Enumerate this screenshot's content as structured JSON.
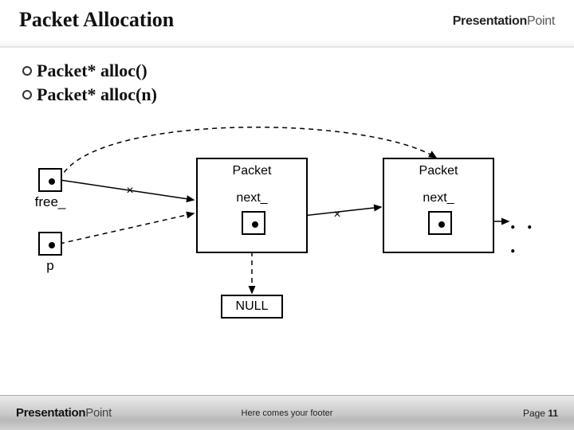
{
  "header": {
    "title": "Packet Allocation",
    "brand_bold": "Presentation",
    "brand_light": "Point"
  },
  "bullets": [
    "Packet* alloc()",
    "Packet* alloc(n)"
  ],
  "diagram": {
    "left_labels": {
      "free": "free_",
      "p": "p"
    },
    "packet1": {
      "title": "Packet",
      "field": "next_"
    },
    "packet2": {
      "title": "Packet",
      "field": "next_"
    },
    "null_box": "NULL",
    "x_mark": "×",
    "ellipsis": ". . ."
  },
  "footer": {
    "brand_bold": "Presentation",
    "brand_light": "Point",
    "center": "Here comes your footer",
    "page_label": "Page ",
    "page_num": "11"
  }
}
